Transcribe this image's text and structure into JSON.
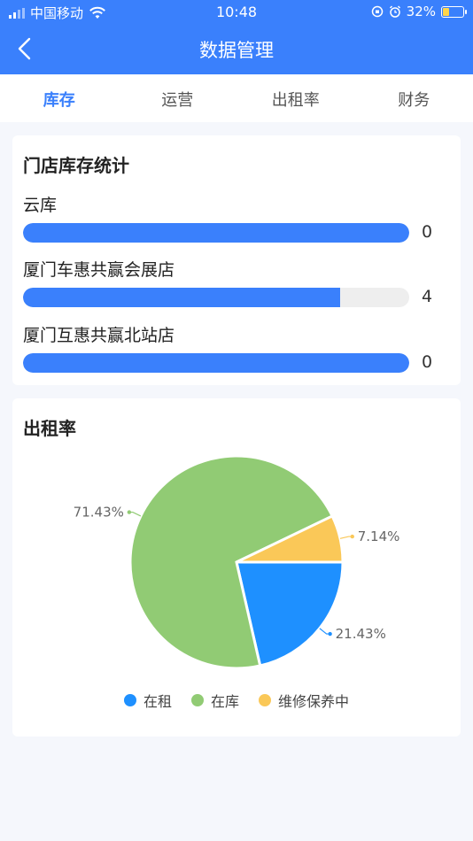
{
  "status_bar": {
    "carrier": "中国移动",
    "time": "10:48",
    "battery": "32%",
    "battery_level": 0.32
  },
  "header": {
    "title": "数据管理"
  },
  "tabs": [
    {
      "label": "库存",
      "active": true
    },
    {
      "label": "运营",
      "active": false
    },
    {
      "label": "出租率",
      "active": false
    },
    {
      "label": "财务",
      "active": false
    }
  ],
  "stock": {
    "title": "门店库存统计",
    "max": 4,
    "items": [
      {
        "name": "云库",
        "value": "0",
        "fill_fraction": 1.0
      },
      {
        "name": "厦门车惠共赢会展店",
        "value": "4",
        "fill_fraction": 0.82
      },
      {
        "name": "厦门互惠共赢北站店",
        "value": "0",
        "fill_fraction": 1.0
      }
    ]
  },
  "rental": {
    "title": "出租率",
    "chart_data": {
      "type": "pie",
      "slices": [
        {
          "name": "在租",
          "value": 21.43,
          "label": "21.43%",
          "color": "#1e90ff"
        },
        {
          "name": "在库",
          "value": 71.43,
          "label": "71.43%",
          "color": "#91cb74"
        },
        {
          "name": "维修保养中",
          "value": 7.14,
          "label": "7.14%",
          "color": "#fac858"
        }
      ],
      "legend": "bottom"
    }
  },
  "colors": {
    "primary": "#3a80fc",
    "track": "#eeeeee"
  }
}
